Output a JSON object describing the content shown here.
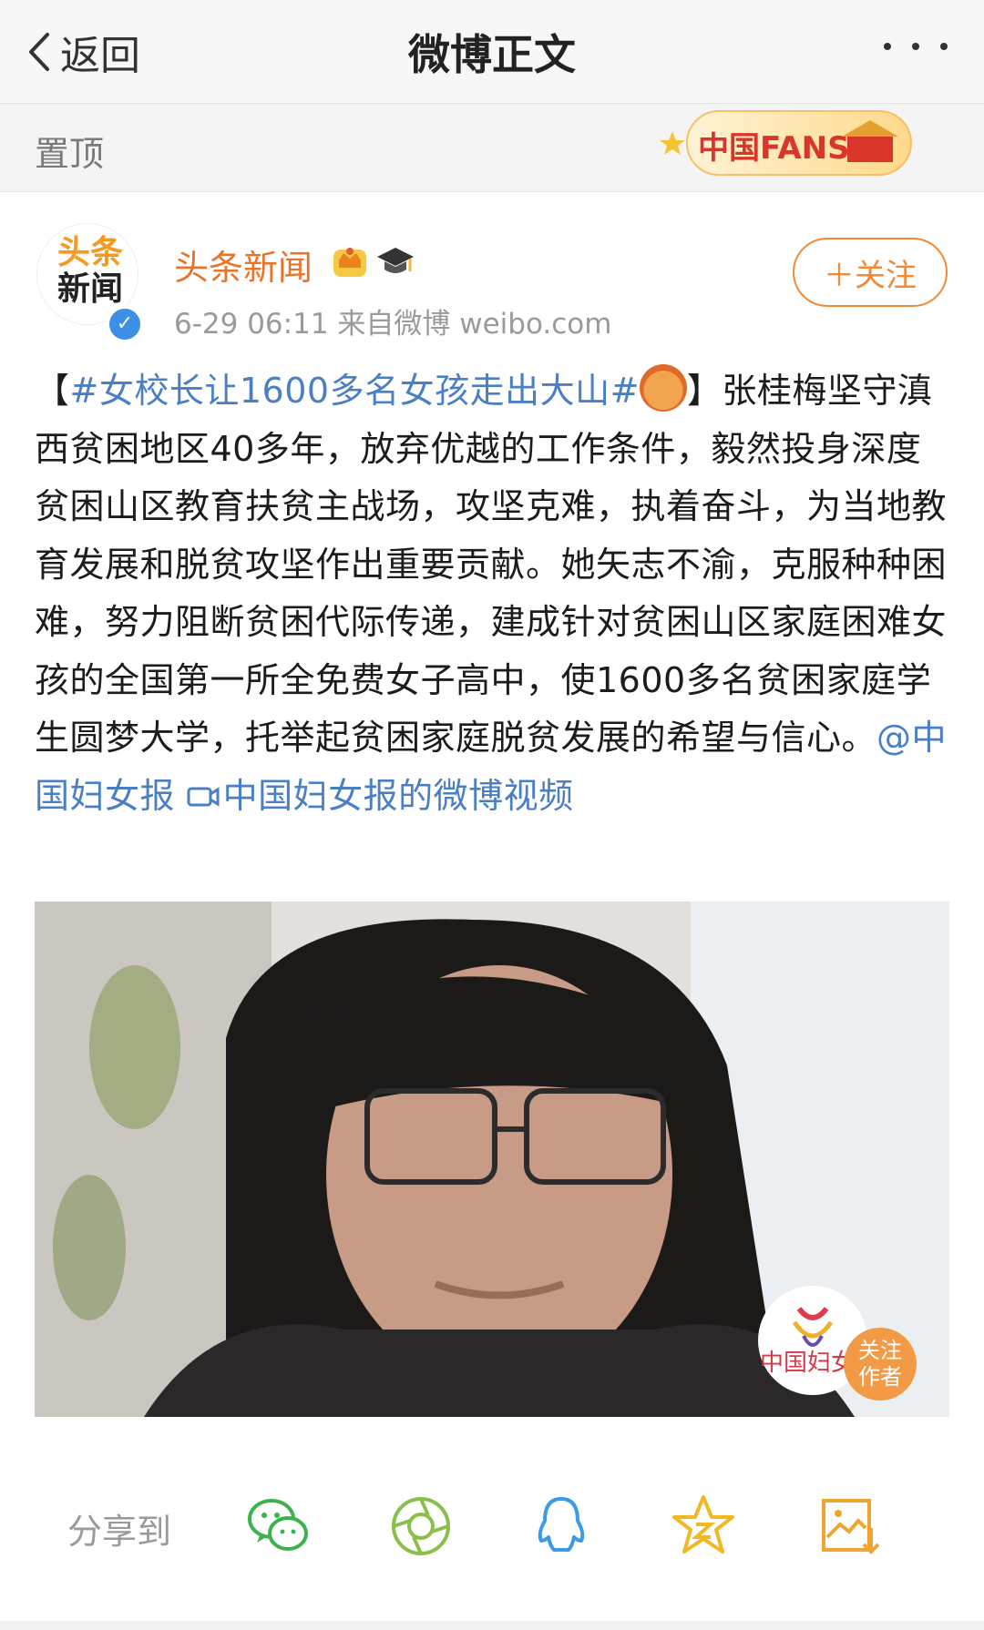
{
  "nav": {
    "back_label": "返回",
    "title": "微博正文"
  },
  "pin": {
    "label": "置顶",
    "badge_text": "中国FANS"
  },
  "author": {
    "avatar_text_line1": "头条",
    "avatar_text_line2": "新闻",
    "name": "头条新闻",
    "meta": "6-29 06:11   来自微博 weibo.com",
    "follow_label": "＋关注"
  },
  "post": {
    "bracket_open": "【",
    "hashtag": "#女校长让1600多名女孩走出大山#",
    "bracket_close": "】",
    "body": "张桂梅坚守滇西贫困地区40多年，放弃优越的工作条件，毅然投身深度贫困山区教育扶贫主战场，攻坚克难，执着奋斗，为当地教育发展和脱贫攻坚作出重要贡献。她矢志不渝，克服种种困难，努力阻断贫困代际传递，建成针对贫困山区家庭困难女孩的全国第一所全免费女子高中，使1600多名贫困家庭学生圆梦大学，托举起贫困家庭脱贫发展的希望与信心。",
    "mention": "@中国妇女报",
    "video_link": "中国妇女报的微博视频"
  },
  "video": {
    "watermark": "中国妇女",
    "follow_author_line1": "关注",
    "follow_author_line2": "作者"
  },
  "share": {
    "label": "分享到",
    "targets": [
      "wechat-icon",
      "moments-icon",
      "qq-icon",
      "qzone-icon",
      "save-image-icon"
    ]
  },
  "colors": {
    "accent": "#f08a38",
    "link": "#4a7fc6",
    "wechat": "#3cb34a",
    "moments": "#8ac04a",
    "qq": "#3b9be8",
    "qzone": "#f1b824",
    "save": "#f0a431"
  }
}
